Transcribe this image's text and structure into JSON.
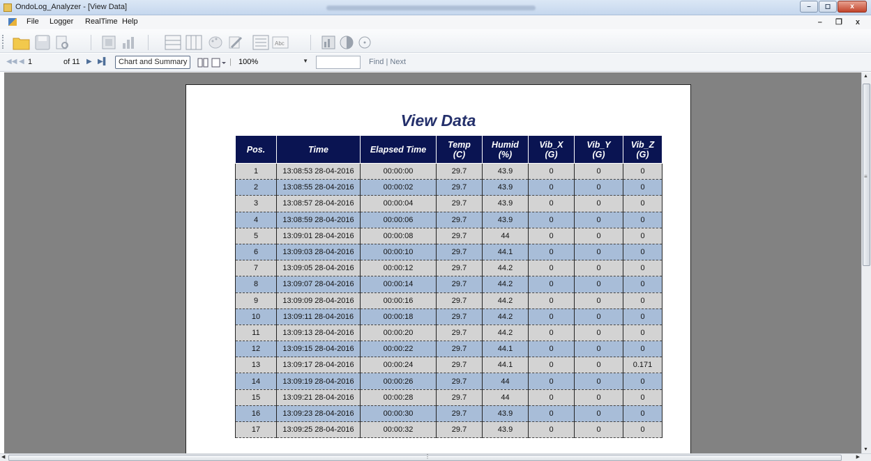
{
  "window": {
    "title": "OndoLog_Analyzer - [View Data]",
    "minimize_glyph": "–",
    "restore_glyph": "◻",
    "close_glyph": "x"
  },
  "menu": {
    "items": [
      "File",
      "Logger",
      "RealTime",
      "Help"
    ],
    "mdi_glyphs": "–  ❐  x"
  },
  "toolbar_icons": [
    "open-folder-icon",
    "save-icon",
    "print-preview-icon",
    "report-icon",
    "bar-chart-icon",
    "table-rows-icon",
    "table-columns-icon",
    "palette-icon",
    "edit-icon",
    "list-icon",
    "text-format-icon",
    "chart-export-icon",
    "pie-chart-icon",
    "circle-target-icon"
  ],
  "report_toolbar": {
    "page_current": "1",
    "page_total": "of 11",
    "tooltip": "Chart and Summary",
    "zoom": "100%",
    "find_label": "Find",
    "separator": "|",
    "next_label": "Next"
  },
  "report": {
    "title": "View Data",
    "columns": [
      {
        "line1": "Pos.",
        "line2": ""
      },
      {
        "line1": "Time",
        "line2": ""
      },
      {
        "line1": "Elapsed Time",
        "line2": ""
      },
      {
        "line1": "Temp",
        "line2": "(C)"
      },
      {
        "line1": "Humid",
        "line2": "(%)"
      },
      {
        "line1": "Vib_X",
        "line2": "(G)"
      },
      {
        "line1": "Vib_Y",
        "line2": "(G)"
      },
      {
        "line1": "Vib_Z",
        "line2": "(G)"
      }
    ],
    "rows": [
      [
        "1",
        "13:08:53 28-04-2016",
        "00:00:00",
        "29.7",
        "43.9",
        "0",
        "0",
        "0"
      ],
      [
        "2",
        "13:08:55 28-04-2016",
        "00:00:02",
        "29.7",
        "43.9",
        "0",
        "0",
        "0"
      ],
      [
        "3",
        "13:08:57 28-04-2016",
        "00:00:04",
        "29.7",
        "43.9",
        "0",
        "0",
        "0"
      ],
      [
        "4",
        "13:08:59 28-04-2016",
        "00:00:06",
        "29.7",
        "43.9",
        "0",
        "0",
        "0"
      ],
      [
        "5",
        "13:09:01 28-04-2016",
        "00:00:08",
        "29.7",
        "44",
        "0",
        "0",
        "0"
      ],
      [
        "6",
        "13:09:03 28-04-2016",
        "00:00:10",
        "29.7",
        "44.1",
        "0",
        "0",
        "0"
      ],
      [
        "7",
        "13:09:05 28-04-2016",
        "00:00:12",
        "29.7",
        "44.2",
        "0",
        "0",
        "0"
      ],
      [
        "8",
        "13:09:07 28-04-2016",
        "00:00:14",
        "29.7",
        "44.2",
        "0",
        "0",
        "0"
      ],
      [
        "9",
        "13:09:09 28-04-2016",
        "00:00:16",
        "29.7",
        "44.2",
        "0",
        "0",
        "0"
      ],
      [
        "10",
        "13:09:11 28-04-2016",
        "00:00:18",
        "29.7",
        "44.2",
        "0",
        "0",
        "0"
      ],
      [
        "11",
        "13:09:13 28-04-2016",
        "00:00:20",
        "29.7",
        "44.2",
        "0",
        "0",
        "0"
      ],
      [
        "12",
        "13:09:15 28-04-2016",
        "00:00:22",
        "29.7",
        "44.1",
        "0",
        "0",
        "0"
      ],
      [
        "13",
        "13:09:17 28-04-2016",
        "00:00:24",
        "29.7",
        "44.1",
        "0",
        "0",
        "0.171"
      ],
      [
        "14",
        "13:09:19 28-04-2016",
        "00:00:26",
        "29.7",
        "44",
        "0",
        "0",
        "0"
      ],
      [
        "15",
        "13:09:21 28-04-2016",
        "00:00:28",
        "29.7",
        "44",
        "0",
        "0",
        "0"
      ],
      [
        "16",
        "13:09:23 28-04-2016",
        "00:00:30",
        "29.7",
        "43.9",
        "0",
        "0",
        "0"
      ],
      [
        "17",
        "13:09:25 28-04-2016",
        "00:00:32",
        "29.7",
        "43.9",
        "0",
        "0",
        "0"
      ]
    ]
  },
  "colors": {
    "header_bg": "#0a1452",
    "title_color": "#24306b",
    "row_odd": "#d3d3d3",
    "row_even": "#a8bdd8",
    "viewport_bg": "#828282"
  }
}
